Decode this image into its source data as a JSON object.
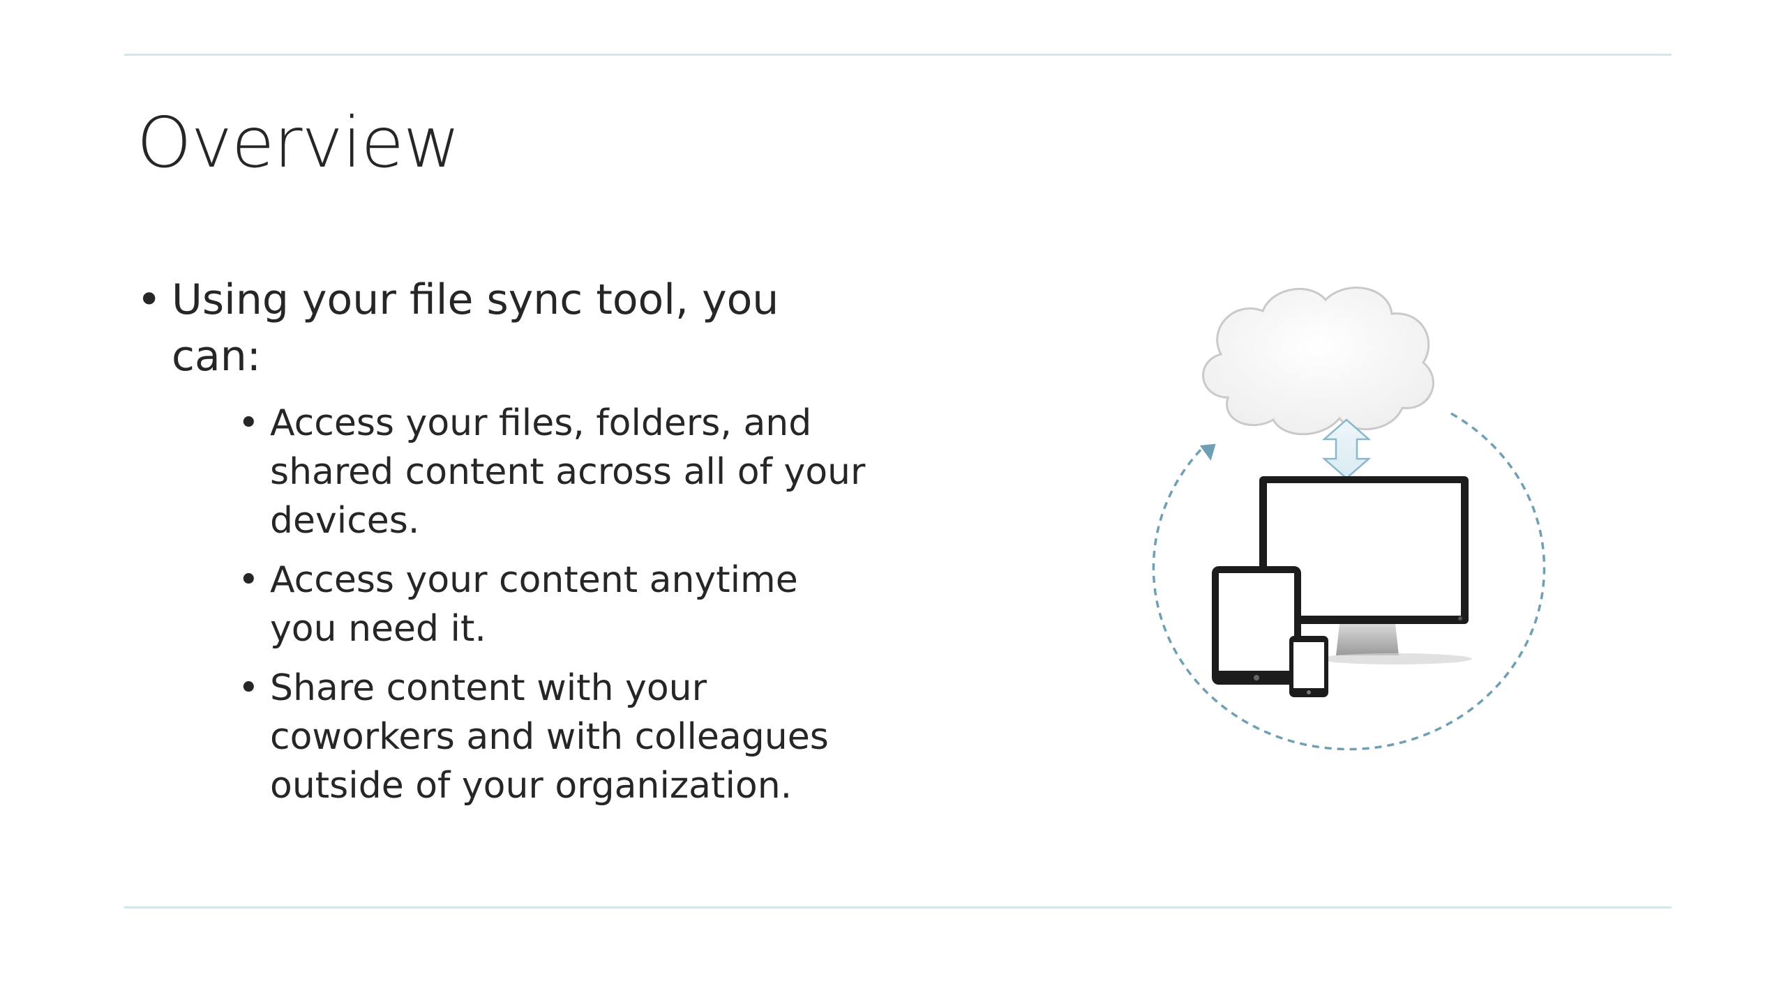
{
  "slide": {
    "title": "Overview",
    "bullet_main": "Using your file sync tool, you can:",
    "sub_bullets": [
      "Access your files, folders, and shared content across all of your devices.",
      "Access your content anytime you need it.",
      "Share content with your coworkers and with colleagues outside of your organization."
    ],
    "bullet_glyph": "•"
  },
  "illustration": {
    "icons": [
      "cloud-icon",
      "sync-arrow-icon",
      "monitor-icon",
      "tablet-icon",
      "phone-icon",
      "sync-cycle-icon"
    ],
    "colors": {
      "accent": "#6f9fb5",
      "rule": "#d4e6ec",
      "device": "#1c1c1c",
      "cloud_outline": "#c9c9c9"
    }
  }
}
